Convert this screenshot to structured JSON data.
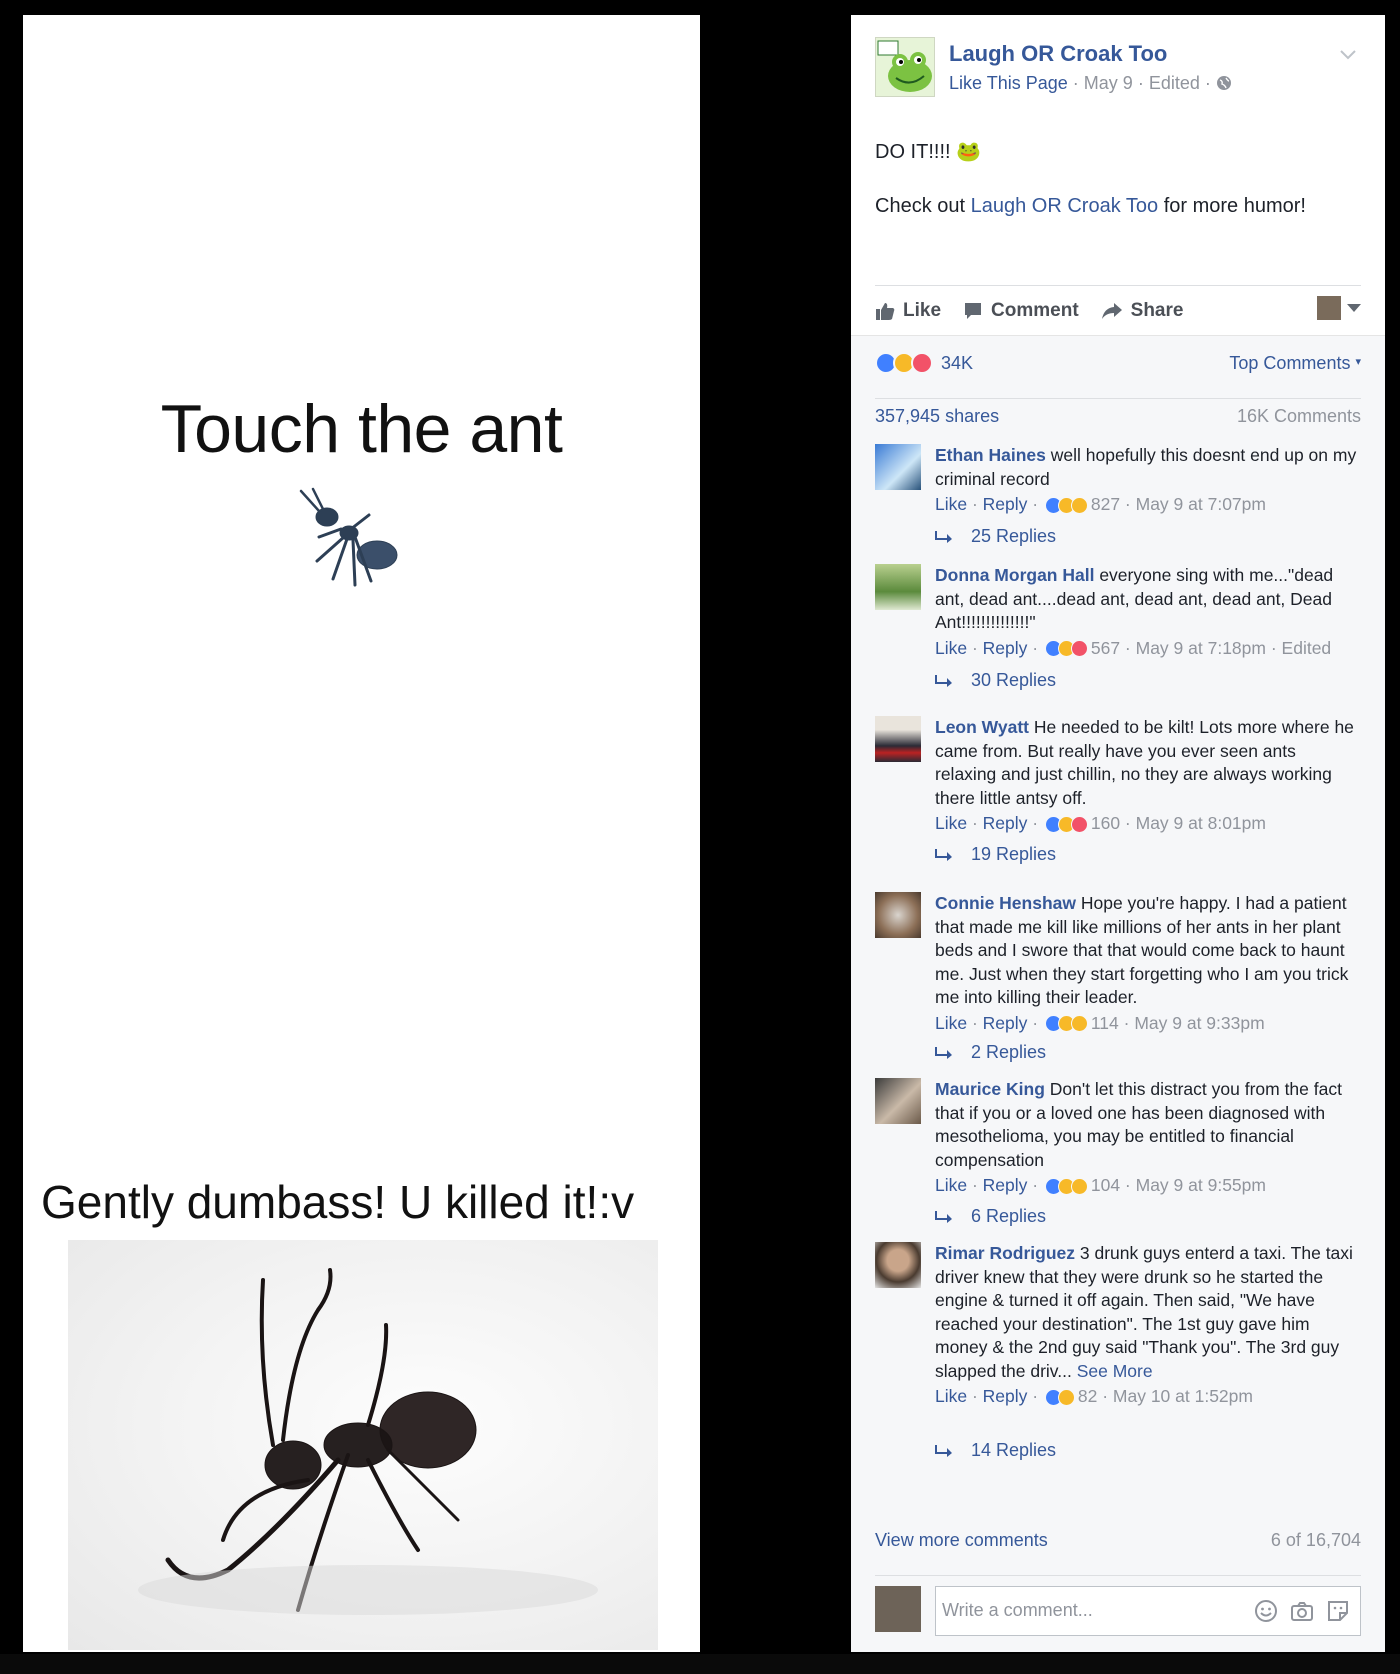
{
  "meme": {
    "top_caption": "Touch the ant",
    "bottom_caption": "Gently dumbass! U killed it!:v"
  },
  "post": {
    "page_name": "Laugh OR Croak Too",
    "like_page": "Like This Page",
    "date": "May 9",
    "edited": "Edited",
    "line1": "DO IT!!!! 🐸",
    "line2_prefix": "Check out ",
    "line2_link": "Laugh OR Croak Too",
    "line2_suffix": " for more humor!"
  },
  "actions": {
    "like": "Like",
    "comment": "Comment",
    "share": "Share"
  },
  "stats": {
    "reactions": "34K",
    "top_comments": "Top Comments",
    "shares": "357,945 shares",
    "comments": "16K Comments"
  },
  "comments": [
    {
      "author": "Ethan Haines",
      "text": " well hopefully this doesnt end up on my criminal record",
      "like": "Like",
      "reply": "Reply",
      "count": "827",
      "time": "May 9 at 7:07pm",
      "edited": "",
      "replies": "25 Replies"
    },
    {
      "author": "Donna Morgan Hall",
      "text": " everyone sing with me...\"dead ant, dead ant....dead ant, dead ant, dead ant, Dead Ant!!!!!!!!!!!!!!\"",
      "like": "Like",
      "reply": "Reply",
      "count": "567",
      "time": "May 9 at 7:18pm",
      "edited": "Edited",
      "replies": "30 Replies"
    },
    {
      "author": "Leon Wyatt",
      "text": " He needed to be kilt! Lots more where he came from. But really have you ever seen ants relaxing and just chillin, no they are always working there little antsy off.",
      "like": "Like",
      "reply": "Reply",
      "count": "160",
      "time": "May 9 at 8:01pm",
      "edited": "",
      "replies": "19 Replies"
    },
    {
      "author": "Connie Henshaw",
      "text": " Hope you're happy. I had a patient that made me kill like millions of her ants in her plant beds and I swore that that would come back to haunt me. Just when they start forgetting who I am you trick me into killing their leader.",
      "like": "Like",
      "reply": "Reply",
      "count": "114",
      "time": "May 9 at 9:33pm",
      "edited": "",
      "replies": "2 Replies"
    },
    {
      "author": "Maurice King",
      "text": " Don't let this distract you from the fact that if you or a loved one has been diagnosed with mesothelioma, you may be entitled to financial compensation",
      "like": "Like",
      "reply": "Reply",
      "count": "104",
      "time": "May 9 at 9:55pm",
      "edited": "",
      "replies": "6 Replies"
    },
    {
      "author": "Rimar Rodriguez",
      "text": " 3 drunk guys enterd a taxi. The taxi driver knew that they were drunk so he started the engine & turned it off again. Then said, \"We have reached your destination\". The 1st guy gave him money & the 2nd guy said \"Thank you\". The 3rd guy slapped the driv...",
      "see_more": "See More",
      "like": "Like",
      "reply": "Reply",
      "count": "82",
      "time": "May 10 at 1:52pm",
      "edited": "",
      "replies": "14 Replies"
    }
  ],
  "footer": {
    "view_more": "View more comments",
    "count_of": "6 of 16,704",
    "write_placeholder": "Write a comment..."
  },
  "colors": {
    "link": "#365899",
    "meta": "#90949c",
    "like_react": "#4080ff",
    "love_react": "#f25268",
    "haha_react": "#f7b928"
  }
}
